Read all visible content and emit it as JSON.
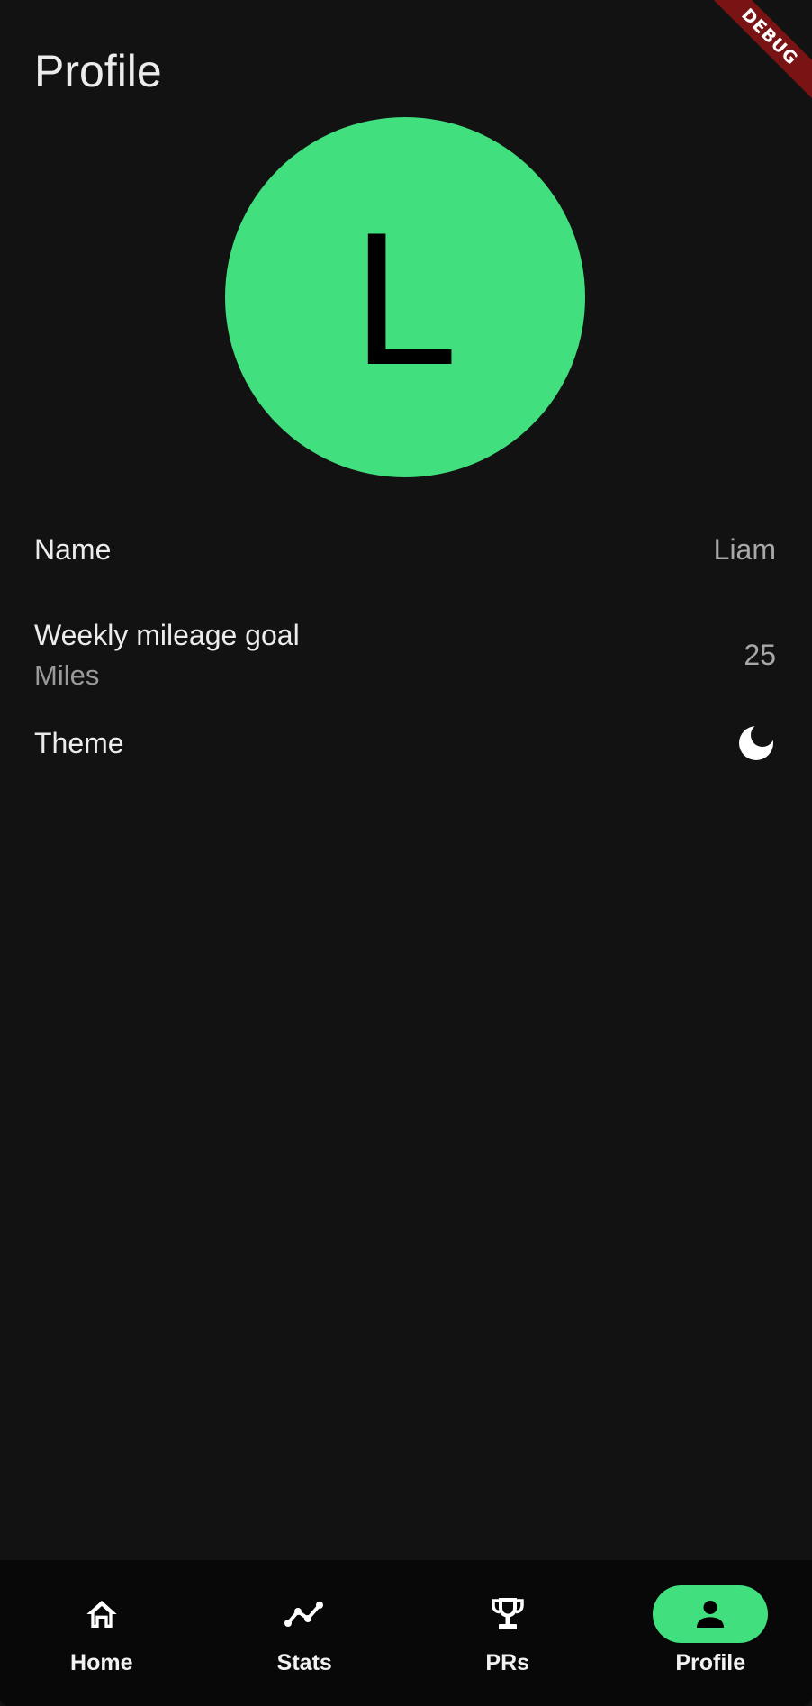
{
  "debug_banner": "DEBUG",
  "header": {
    "title": "Profile"
  },
  "avatar": {
    "initial": "L",
    "color": "#41df7e"
  },
  "settings": {
    "name": {
      "label": "Name",
      "value": "Liam"
    },
    "weekly_goal": {
      "label": "Weekly mileage goal",
      "sublabel": "Miles",
      "value": "25"
    },
    "theme": {
      "label": "Theme",
      "icon": "moon-icon"
    }
  },
  "bottom_nav": {
    "items": [
      {
        "label": "Home",
        "icon": "home-icon",
        "active": false
      },
      {
        "label": "Stats",
        "icon": "chart-line-icon",
        "active": false
      },
      {
        "label": "PRs",
        "icon": "trophy-icon",
        "active": false
      },
      {
        "label": "Profile",
        "icon": "person-icon",
        "active": true
      }
    ],
    "active_color": "#41df7e"
  }
}
